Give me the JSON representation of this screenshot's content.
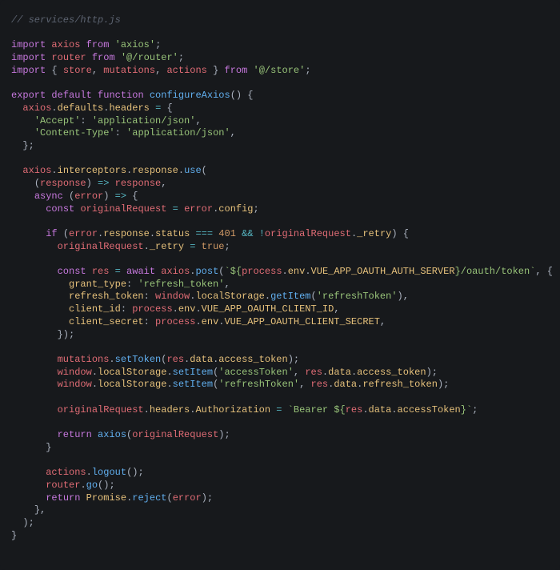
{
  "file_comment": "// services/http.js",
  "code": {
    "imports": [
      {
        "default": "axios",
        "from": "'axios'"
      },
      {
        "default": "router",
        "from": "'@/router'"
      },
      {
        "named": [
          "store",
          "mutations",
          "actions"
        ],
        "from": "'@/store'"
      }
    ],
    "function_name": "configureAxios",
    "headers": {
      "Accept": "'application/json'",
      "Content-Type": "'application/json'"
    },
    "interceptor": {
      "success_param": "response",
      "error_param": "error",
      "original_request_var": "originalRequest",
      "status_check": "401",
      "retry_flag": "_retry",
      "retry_value": "true",
      "post_url_template": "`${process.env.VUE_APP_OAUTH_AUTH_SERVER}/oauth/token`",
      "post_body": {
        "grant_type": "'refresh_token'",
        "refresh_token_expr": "window.localStorage.getItem('refreshToken')",
        "client_id_expr": "process.env.VUE_APP_OAUTH_CLIENT_ID",
        "client_secret_expr": "process.env.VUE_APP_OAUTH_CLIENT_SECRET"
      },
      "set_token_call": "mutations.setToken(res.data.access_token)",
      "ls_access_key": "'accessToken'",
      "ls_access_val": "res.data.access_token",
      "ls_refresh_key": "'refreshToken'",
      "ls_refresh_val": "res.data.refresh_token",
      "auth_header_template": "`Bearer ${res.data.accessToken}`",
      "return_retry": "axios(originalRequest)",
      "logout_call": "actions.logout()",
      "router_call": "router.go()",
      "reject_call": "Promise.reject(error)"
    }
  },
  "tokens": {
    "l1": "// services/http.js",
    "k_import": "import",
    "k_from": "from",
    "k_export": "export",
    "k_default": "default",
    "k_function": "function",
    "k_const": "const",
    "k_async": "async",
    "k_if": "if",
    "k_return": "return",
    "k_await": "await",
    "id_axios": "axios",
    "id_router": "router",
    "id_store": "store",
    "id_mutations": "mutations",
    "id_actions": "actions",
    "s_axios": "'axios'",
    "s_router": "'@/router'",
    "s_store": "'@/store'",
    "fn_configure": "configureAxios",
    "p_defaults": "defaults",
    "p_headers": "headers",
    "s_accept": "'Accept'",
    "s_appjson": "'application/json'",
    "s_ctype": "'Content-Type'",
    "p_interceptors": "interceptors",
    "p_response": "response",
    "fn_use": "use",
    "id_response": "response",
    "id_error": "error",
    "id_origReq": "originalRequest",
    "p_config": "config",
    "p_status": "status",
    "n_401": "401",
    "p_retry": "_retry",
    "b_true": "true",
    "id_res": "res",
    "fn_post": "post",
    "s_tpl_open": "`${",
    "id_process": "process",
    "p_env": "env",
    "c_authserver": "VUE_APP_OAUTH_AUTH_SERVER",
    "s_tpl_path": "}/oauth/token`",
    "p_grant": "grant_type",
    "s_refresh": "'refresh_token'",
    "p_reftok": "refresh_token",
    "id_window": "window",
    "p_localStorage": "localStorage",
    "fn_getItem": "getItem",
    "s_refreshToken": "'refreshToken'",
    "p_clientid": "client_id",
    "c_clientid": "VUE_APP_OAUTH_CLIENT_ID",
    "p_clientsecret": "client_secret",
    "c_clientsecret": "VUE_APP_OAUTH_CLIENT_SECRET",
    "fn_setToken": "setToken",
    "p_data": "data",
    "p_access_token": "access_token",
    "fn_setItem": "setItem",
    "s_accessToken": "'accessToken'",
    "p_refresh_token": "refresh_token",
    "p_Authorization": "Authorization",
    "s_bearer_open": "`Bearer ${",
    "p_accessToken": "accessToken",
    "s_bearer_close": "}`",
    "fn_logout": "logout",
    "fn_go": "go",
    "id_Promise": "Promise",
    "fn_reject": "reject"
  }
}
